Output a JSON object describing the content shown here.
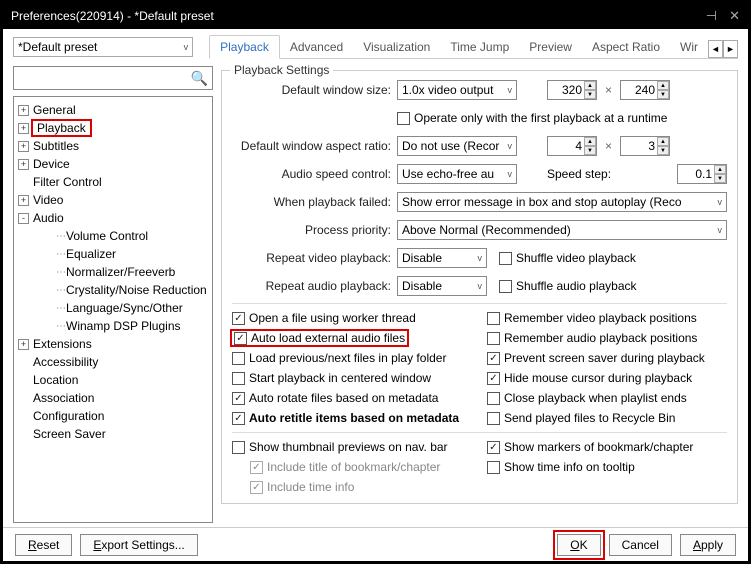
{
  "title": "Preferences(220914) - *Default preset",
  "preset": "*Default preset",
  "tabs": [
    "Playback",
    "Advanced",
    "Visualization",
    "Time Jump",
    "Preview",
    "Aspect Ratio",
    "Wir"
  ],
  "active_tab": 0,
  "tree": [
    {
      "label": "General",
      "depth": 0,
      "exp": "+"
    },
    {
      "label": "Playback",
      "depth": 0,
      "exp": "+",
      "highlight": true
    },
    {
      "label": "Subtitles",
      "depth": 0,
      "exp": "+"
    },
    {
      "label": "Device",
      "depth": 0,
      "exp": "+"
    },
    {
      "label": "Filter Control",
      "depth": 0,
      "exp": ""
    },
    {
      "label": "Video",
      "depth": 0,
      "exp": "+"
    },
    {
      "label": "Audio",
      "depth": 0,
      "exp": "-"
    },
    {
      "label": "Volume Control",
      "depth": 2,
      "exp": ""
    },
    {
      "label": "Equalizer",
      "depth": 2,
      "exp": ""
    },
    {
      "label": "Normalizer/Freeverb",
      "depth": 2,
      "exp": ""
    },
    {
      "label": "Crystality/Noise Reduction",
      "depth": 2,
      "exp": ""
    },
    {
      "label": "Language/Sync/Other",
      "depth": 2,
      "exp": ""
    },
    {
      "label": "Winamp DSP Plugins",
      "depth": 2,
      "exp": ""
    },
    {
      "label": "Extensions",
      "depth": 0,
      "exp": "+"
    },
    {
      "label": "Accessibility",
      "depth": 0,
      "exp": ""
    },
    {
      "label": "Location",
      "depth": 0,
      "exp": ""
    },
    {
      "label": "Association",
      "depth": 0,
      "exp": ""
    },
    {
      "label": "Configuration",
      "depth": 0,
      "exp": ""
    },
    {
      "label": "Screen Saver",
      "depth": 0,
      "exp": ""
    }
  ],
  "playback": {
    "legend": "Playback Settings",
    "default_window_size_label": "Default window size:",
    "default_window_size": "1.0x video output",
    "size_w": "320",
    "size_h": "240",
    "operate_first_only": "Operate only with the first playback at a runtime",
    "aspect_label": "Default window aspect ratio:",
    "aspect_value": "Do not use (Recor",
    "aspect_a": "4",
    "aspect_b": "3",
    "audio_speed_label": "Audio speed control:",
    "audio_speed_value": "Use echo-free au",
    "speed_step_label": "Speed step:",
    "speed_step_value": "0.1",
    "failed_label": "When playback failed:",
    "failed_value": "Show error message in box and stop autoplay (Reco",
    "priority_label": "Process priority:",
    "priority_value": "Above Normal (Recommended)",
    "repeat_video_label": "Repeat video playback:",
    "repeat_video_value": "Disable",
    "shuffle_video": "Shuffle video playback",
    "repeat_audio_label": "Repeat audio playback:",
    "repeat_audio_value": "Disable",
    "shuffle_audio": "Shuffle audio playback",
    "colA": [
      {
        "label": "Open a file using worker thread",
        "checked": true
      },
      {
        "label": "Auto load external audio files",
        "checked": true,
        "highlight": true
      },
      {
        "label": "Load previous/next files in play folder",
        "checked": false
      },
      {
        "label": "Start playback in centered window",
        "checked": false
      },
      {
        "label": "Auto rotate files based on metadata",
        "checked": true
      },
      {
        "label": "Auto retitle items based on metadata",
        "checked": true,
        "bold": true
      }
    ],
    "colB": [
      {
        "label": "Remember video playback positions",
        "checked": false
      },
      {
        "label": "Remember audio playback positions",
        "checked": false
      },
      {
        "label": "Prevent screen saver during playback",
        "checked": true
      },
      {
        "label": "Hide mouse cursor during playback",
        "checked": true
      },
      {
        "label": "Close playback when playlist ends",
        "checked": false
      },
      {
        "label": "Send played files to Recycle Bin",
        "checked": false
      }
    ],
    "colA2": [
      {
        "label": "Show thumbnail previews on nav. bar",
        "checked": false
      },
      {
        "label": "Include title of bookmark/chapter",
        "checked": true,
        "disabled": true
      },
      {
        "label": "Include time info",
        "checked": true,
        "disabled": true
      }
    ],
    "colB2": [
      {
        "label": "Show markers of bookmark/chapter",
        "checked": true
      },
      {
        "label": "Show time info on tooltip",
        "checked": false
      }
    ]
  },
  "buttons": {
    "reset": "Reset",
    "export": "Export Settings...",
    "ok": "OK",
    "cancel": "Cancel",
    "apply": "Apply"
  }
}
